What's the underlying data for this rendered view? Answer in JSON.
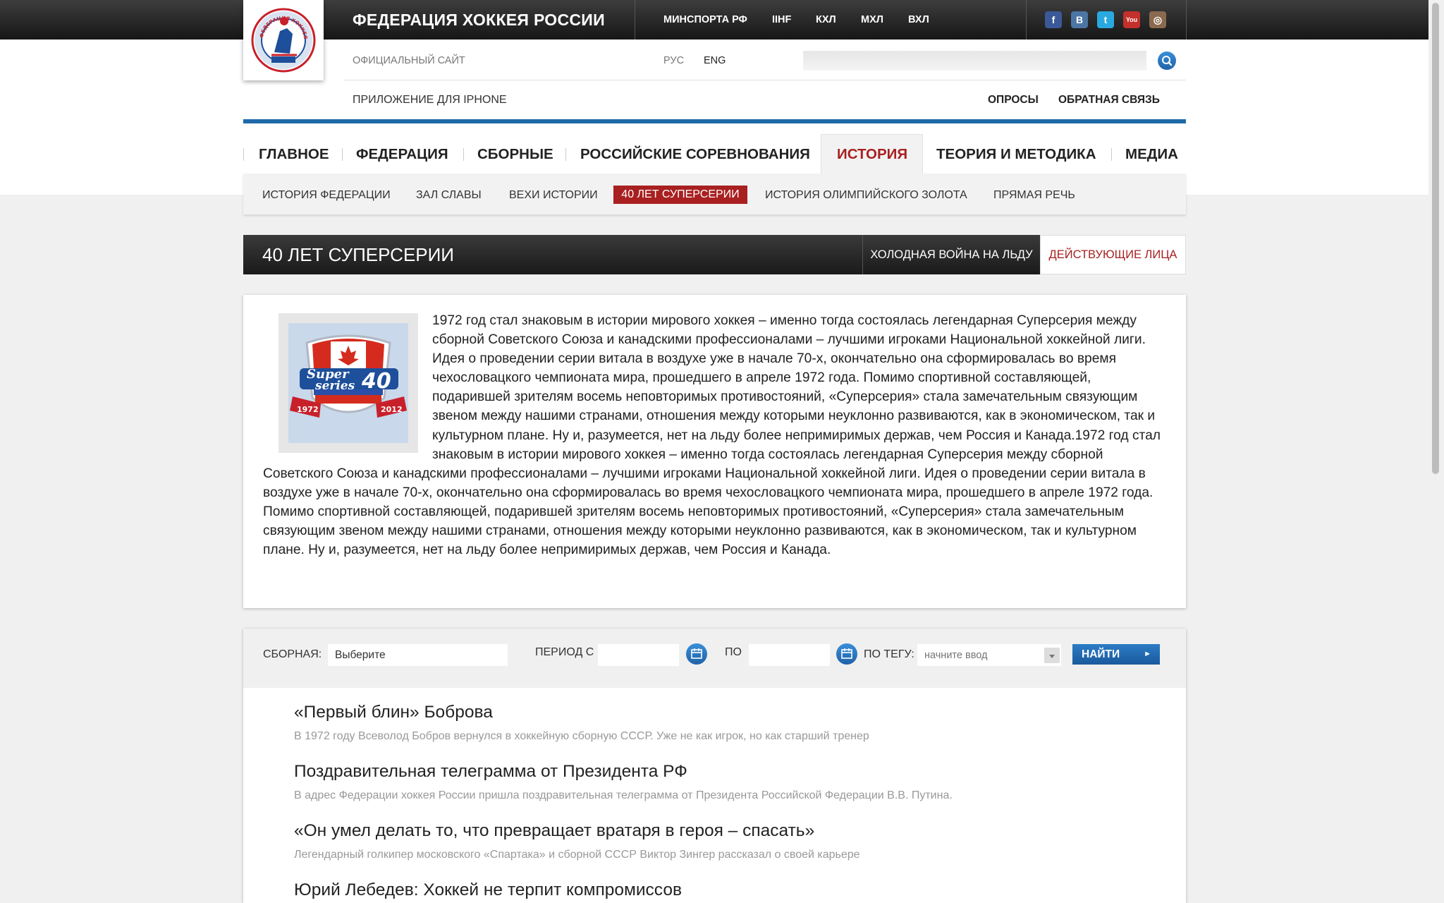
{
  "header": {
    "site_title": "ФЕДЕРАЦИЯ ХОККЕЯ РОССИИ",
    "logo_text": "ФЕДЕРАЦИЯ ХОККЕЯ РОССИИ",
    "top_links": [
      "МИНСПОРТА РФ",
      "IIHF",
      "КХЛ",
      "МХЛ",
      "ВХЛ"
    ],
    "social": [
      {
        "name": "facebook-icon",
        "glyph": "f",
        "color": "#3b5998"
      },
      {
        "name": "vkontakte-icon",
        "glyph": "B",
        "color": "#4c75a3"
      },
      {
        "name": "twitter-icon",
        "glyph": "t",
        "color": "#2aa9e0"
      },
      {
        "name": "youtube-icon",
        "glyph": "You",
        "color": "#c4302b"
      },
      {
        "name": "instagram-icon",
        "glyph": "◎",
        "color": "#8a6a4f"
      }
    ],
    "subtitle": "ОФИЦИАЛЬНЫЙ САЙТ",
    "lang_ru": "РУС",
    "lang_en": "ENG",
    "search_placeholder": "",
    "iphone_app": "ПРИЛОЖЕНИЕ ДЛЯ IPHONE",
    "polls": "ОПРОСЫ",
    "feedback": "ОБРАТНАЯ СВЯЗЬ"
  },
  "nav": {
    "items": [
      "ГЛАВНОЕ",
      "ФЕДЕРАЦИЯ",
      "СБОРНЫЕ",
      "РОССИЙСКИЕ СОРЕВНОВАНИЯ",
      "ИСТОРИЯ",
      "ТЕОРИЯ И МЕТОДИКА",
      "МЕДИА"
    ],
    "active": "ИСТОРИЯ",
    "active_color": "#a82020"
  },
  "subnav": {
    "items": [
      "ИСТОРИЯ ФЕДЕРАЦИИ",
      "ЗАЛ СЛАВЫ",
      "ВЕХИ ИСТОРИИ",
      "40 ЛЕТ СУПЕРСЕРИИ",
      "ИСТОРИЯ ОЛИМПИЙСКОГО ЗОЛОТА",
      "ПРЯМАЯ РЕЧЬ"
    ],
    "active": "40 ЛЕТ СУПЕРСЕРИИ"
  },
  "section": {
    "title": "40 ЛЕТ СУПЕРСЕРИИ",
    "tab_cold_war": "ХОЛОДНАЯ ВОЙНА НА ЛЬДУ",
    "tab_people": "ДЕЙСТВУЮЩИЕ ЛИЦА"
  },
  "article": {
    "image_caption_top": "Super",
    "image_caption_mid": "series",
    "image_number": "40",
    "image_year_left": "1972",
    "image_year_right": "2012",
    "text": "1972 год стал знаковым в истории мирового хоккея – именно тогда состоялась легендарная Суперсерия между сборной Советского Союза и канадскими профессионалами – лучшими игроками Национальной хоккейной лиги. Идея о проведении серии витала в воздухе уже в начале 70-х, окончательно она сформировалась во время чехословацкого чемпионата мира, прошедшего в апреле 1972 года. Помимо спортивной составляющей, подарившей зрителям восемь неповторимых противостояний, «Суперсерия» стала замечательным связующим звеном между нашими странами, отношения между которыми неуклонно развиваются, как в экономическом, так и культурном плане. Ну и, разумеется, нет на льду более непримиримых держав, чем Россия и Канада.1972 год стал знаковым в истории мирового хоккея – именно тогда состоялась легендарная Суперсерия между сборной Советского Союза и канадскими профессионалами – лучшими игроками Национальной хоккейной лиги. Идея о проведении серии витала в воздухе уже в начале 70-х, окончательно она сформировалась во время чехословацкого чемпионата мира, прошедшего в апреле 1972 года. Помимо спортивной составляющей, подарившей зрителям восемь неповторимых противостояний, «Суперсерия» стала замечательным связующим звеном между нашими странами, отношения между которыми неуклонно развиваются, как в экономическом, так и культурном плане. Ну и, разумеется, нет на льду более непримиримых держав, чем Россия и Канада."
  },
  "filter": {
    "team_label": "СБОРНАЯ:",
    "team_value": "Выберите",
    "period_from_label": "ПЕРИОД С",
    "period_from_value": "",
    "period_to_label": "ПО",
    "period_to_value": "",
    "tag_label": "ПО ТЕГУ:",
    "tag_placeholder": "начните ввод",
    "find_button": "НАЙТИ"
  },
  "news": [
    {
      "title": "«Первый блин» Боброва",
      "desc": "В 1972 году Всеволод Бобров вернулся в хоккейную сборную СССР. Уже не как игрок, но как старший тренер"
    },
    {
      "title": "Поздравительная телеграмма от Президента РФ",
      "desc": "В адрес Федерации хоккея России пришла поздравительная телеграмма от Президента Российской Федерации В.В. Путина."
    },
    {
      "title": "«Он умел делать то, что превращает вратаря в героя – спасать»",
      "desc": "Легендарный голкипер московского «Спартака» и сборной СССР Виктор Зингер рассказал о своей карьере"
    },
    {
      "title": "Юрий Лебедев: Хоккей не терпит компромиссов",
      "desc": ""
    }
  ]
}
